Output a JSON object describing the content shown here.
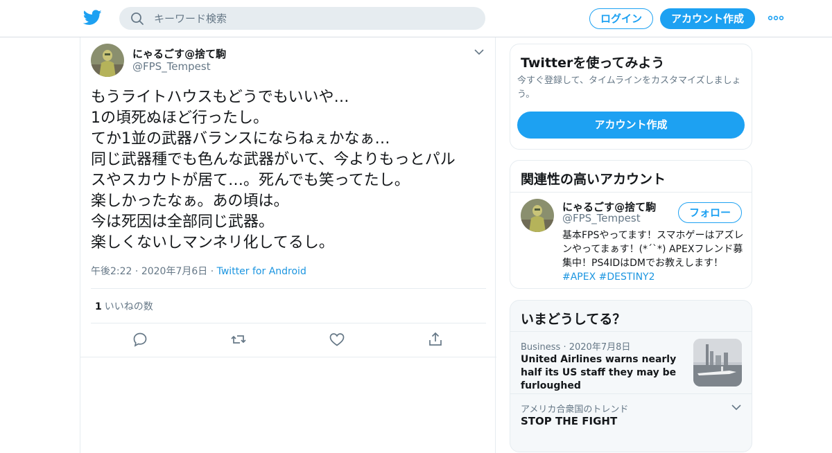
{
  "header": {
    "search_placeholder": "キーワード検索",
    "login_label": "ログイン",
    "signup_label": "アカウント作成"
  },
  "tweet": {
    "author_name": "にゃるごす@捨て駒",
    "author_handle": "@FPS_Tempest",
    "lines": [
      "もうライトハウスもどうでもいいや…",
      "1の頃死ぬほど行ったし。",
      "てか1並の武器バランスにならねぇかなぁ…",
      "同じ武器種でも色んな武器がいて、今よりもっとパル",
      "スやスカウトが居て…。死んでも笑ってたし。",
      "楽しかったなぁ。あの頃は。",
      "今は死因は全部同じ武器。",
      "楽しくないしマンネリ化してるし。"
    ],
    "time": "午後2:22",
    "date": "2020年7月6日",
    "source": "Twitter for Android",
    "like_count": "1",
    "like_label": "いいねの数"
  },
  "signup_card": {
    "title": "Twitterを使ってみよう",
    "description": "今すぐ登録して、タイムラインをカスタマイズしましょう。",
    "button_label": "アカウント作成"
  },
  "related_card": {
    "title": "関連性の高いアカウント",
    "account_name": "にゃるごす@捨て駒",
    "account_handle": "@FPS_Tempest",
    "follow_label": "フォロー",
    "bio": "基本FPSやってます！スマホゲーはアズレンやってまぁす！(*´𝅳`*) APEXフレンド募集中！PS4IDはDMでお教えします！",
    "hashtags": [
      "#APEX",
      "#DESTINY2"
    ]
  },
  "trends_card": {
    "title": "いまどうしてる？",
    "news_category": "Business",
    "news_date": "2020年7月8日",
    "news_headline": "United Airlines warns nearly half its US staff they may be furloughed",
    "trend_category": "アメリカ合衆国のトレンド",
    "trend_name": "STOP THE FIGHT"
  },
  "colors": {
    "accent": "#1da1f2",
    "link": "#1b95e0",
    "text": "#14171a",
    "secondary": "#657786"
  }
}
